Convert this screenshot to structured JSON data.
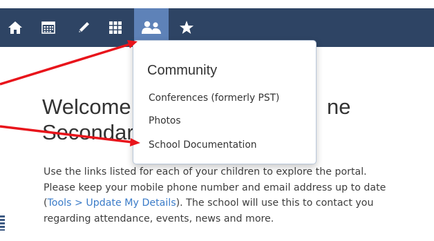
{
  "navbar": {
    "items": [
      {
        "icon": "home-icon"
      },
      {
        "icon": "calendar-icon"
      },
      {
        "icon": "pencil-icon"
      },
      {
        "icon": "grid-icon"
      },
      {
        "icon": "community-icon",
        "active": true
      },
      {
        "icon": "star-icon"
      }
    ],
    "background": "#2e4464",
    "active_background": "#5e82b8"
  },
  "dropdown": {
    "title": "Community",
    "items": [
      {
        "label": "Conferences (formerly PST)"
      },
      {
        "label": "Photos"
      },
      {
        "label": "School Documentation"
      }
    ]
  },
  "main": {
    "welcome_line1_left": "Welcome",
    "welcome_line1_right": "ne",
    "welcome_line2": "Secondar",
    "intro_line1": "Use the links listed for each of your children to explore the portal.",
    "intro_line2": "Please keep your mobile phone number and email address up to date",
    "intro_line3_open": "(",
    "intro_link": "Tools > Update My Details",
    "intro_line3_rest": "). The school will use this to contact you",
    "intro_line4": "regarding attendance, events, news and more."
  },
  "annotation": {
    "arrow_color": "#e8141b"
  }
}
